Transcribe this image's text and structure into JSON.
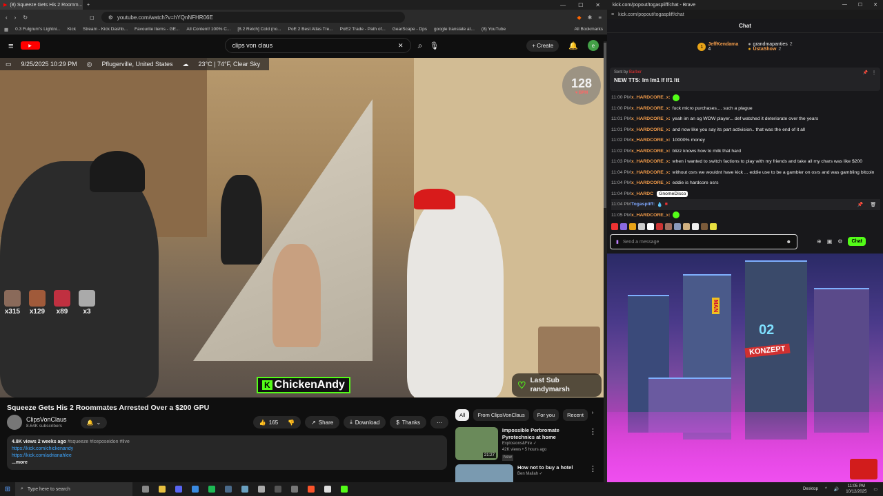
{
  "browser_left": {
    "tab_title": "(8) Squeeze Gets His 2 Roomm...",
    "url": "youtube.com/watch?v=hYQnNFHR06E",
    "bookmarks": [
      "0.3 Fulgrum's Lightni...",
      "Kick",
      "Stream - Kick Dashb...",
      "Favourite Items - GE...",
      "All Content! 100% C...",
      "[8.2 Retch] Cold (no...",
      "PoE 2 Best Atlas Tre...",
      "PoE2 Trade - Path of...",
      "GearScape - Dps",
      "google translate at...",
      "(8) YouTube",
      "All Bookmarks"
    ]
  },
  "youtube": {
    "search_value": "clips von claus",
    "create_label": "Create",
    "avatar_letter": "e",
    "notif_count": "9+"
  },
  "video": {
    "date": "9/25/2025 10:29 PM",
    "location": "Pflugerville, United States",
    "weather": "23°C | 74°F, Clear Sky",
    "bpm": "128",
    "bpm_label": "♥ BPM",
    "emotes": [
      {
        "count": "x315",
        "color": "#8a6a5a"
      },
      {
        "count": "x129",
        "color": "#a05a3a"
      },
      {
        "count": "x89",
        "color": "#c03040"
      },
      {
        "count": "x3",
        "color": "#aaaaaa"
      }
    ],
    "name_card": "ChickenAndy",
    "name_card_badge": "K",
    "last_sub_title": "Last Sub",
    "last_sub_name": "randymarsh"
  },
  "info": {
    "title": "Squeeze Gets His 2 Roommates Arrested Over a $200 GPU",
    "channel": "ClipsVonClaus",
    "subscribers": "8.64K subscribers",
    "likes": "165",
    "share": "Share",
    "download": "Download",
    "thanks": "Thanks",
    "views": "4.8K views  2 weeks ago",
    "tags": "#squeeze #iceposeidon #live",
    "link1": "https://kick.com/chickenandy",
    "link2": "https://kick.com/adrianahlee",
    "more": "...more"
  },
  "chips": [
    "All",
    "From ClipsVonClaus",
    "For you",
    "Recent"
  ],
  "recs": [
    {
      "title": "Impossible Perbromate Pyrotechnics at home",
      "channel": "Explosions&Fire ✓",
      "meta": "42K views • 5 hours ago",
      "badge": "New",
      "duration": "21:27",
      "color": "#6a8a5a"
    },
    {
      "title": "How not to buy a hotel",
      "channel": "Ben Mallah ✓",
      "meta": "",
      "badge": "",
      "duration": "",
      "color": "#7a9ab0"
    }
  ],
  "browser_right": {
    "title": "kick.com/popout/togaspliff/chat - Brave",
    "url": "kick.com/popout/togaspliff/chat"
  },
  "chat": {
    "header": "Chat",
    "leaders": [
      {
        "rank": "1",
        "name": "JeffKendama",
        "count": "4"
      },
      {
        "name": "grandmapanties",
        "count": "2"
      },
      {
        "name": "UstaShow",
        "count": "2"
      }
    ],
    "pinned_by": "Sent by",
    "pinned_user": "Barber",
    "pinned_msg": "NEW TTS: Im Im1 If If1 Itt",
    "messages": [
      {
        "time": "11:00 PM",
        "user": "x_HARDCORE_x:",
        "text": ""
      },
      {
        "time": "11:00 PM",
        "user": "x_HARDCORE_x:",
        "text": "fuck micro purchases.... such a plague"
      },
      {
        "time": "11:01 PM",
        "user": "x_HARDCORE_x:",
        "text": "yeah im an og WOW player... def watched it deteriorate over the years"
      },
      {
        "time": "11:01 PM",
        "user": "x_HARDCORE_x:",
        "text": "and now like you say its part activision.. that was the end of it all"
      },
      {
        "time": "11:02 PM",
        "user": "x_HARDCORE_x:",
        "text": "10000% money"
      },
      {
        "time": "11:02 PM",
        "user": "x_HARDCORE_x:",
        "text": "blizz knows how to milk that hard"
      },
      {
        "time": "11:03 PM",
        "user": "x_HARDCORE_x:",
        "text": "when i wanted to switch factions to play with my friends and take all my chars was like $200"
      },
      {
        "time": "11:04 PM",
        "user": "x_HARDCORE_x:",
        "text": "without osrs we wouldnt have kick ... eddie use to be a gambler on osrs and was gambling bitcoin"
      },
      {
        "time": "11:04 PM",
        "user": "x_HARDCORE_x:",
        "text": "eddie is hardcore osrs"
      },
      {
        "time": "11:04 PM",
        "user": "x_HARDC",
        "text": ""
      },
      {
        "time": "11:04 PM",
        "user": "Togaspliff:",
        "text": ""
      },
      {
        "time": "11:05 PM",
        "user": "x_HARDCORE_x:",
        "text": ""
      }
    ],
    "tooltip": "GnomeDisco",
    "input_placeholder": "Send a message",
    "chat_button": "Chat"
  },
  "stream_overlay": {
    "sign1": "02",
    "sign2": "KONZEPT",
    "sign3": "MAN"
  },
  "taskbar": {
    "search": "Type here to search",
    "desktop": "Desktop",
    "time": "11:05 PM",
    "date": "10/12/2025"
  }
}
